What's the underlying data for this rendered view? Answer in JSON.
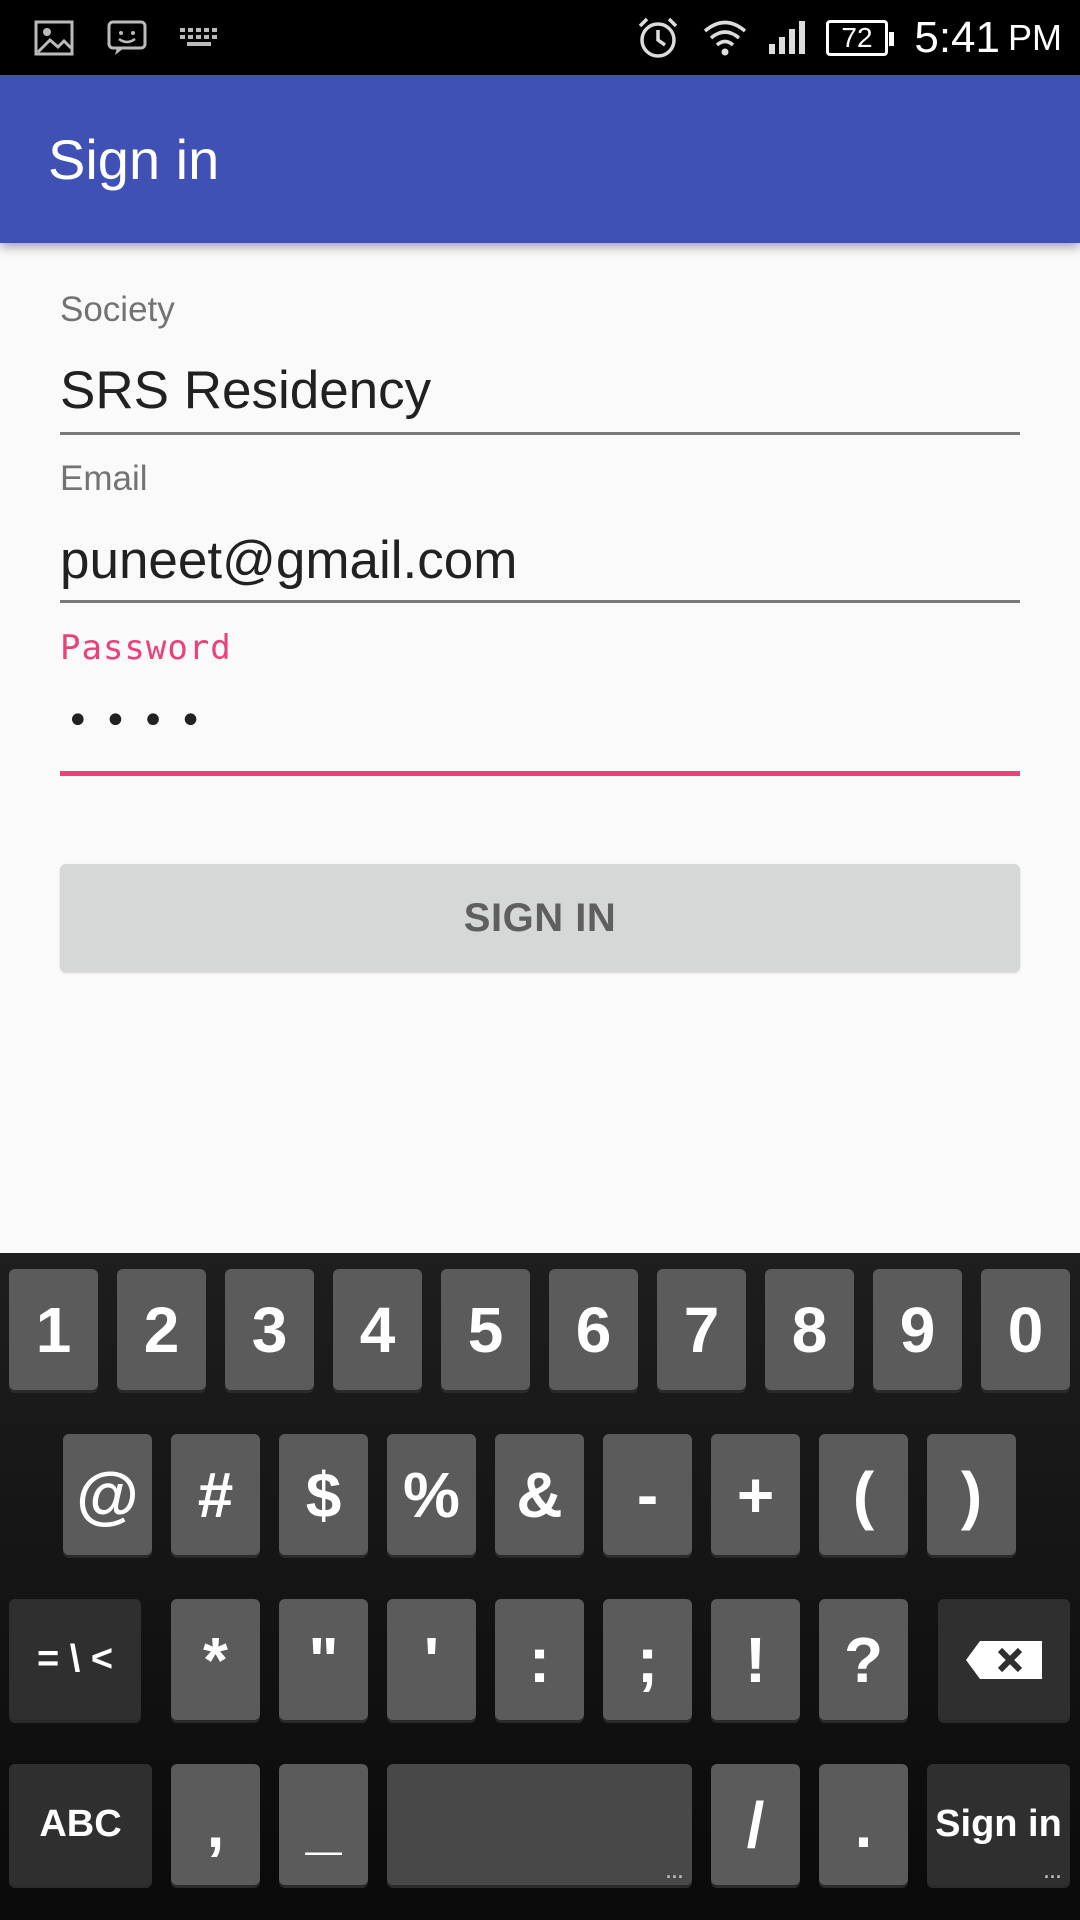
{
  "status_bar": {
    "icons": [
      "image-icon",
      "messenger-icon",
      "keyboard-icon",
      "alarm-icon",
      "wifi-icon",
      "signal-icon"
    ],
    "battery_level": "72",
    "time": "5:41",
    "ampm": "PM"
  },
  "app_bar": {
    "title": "Sign in",
    "color": "#3f51b5"
  },
  "form": {
    "society": {
      "label": "Society",
      "value": "SRS Residency"
    },
    "email": {
      "label": "Email",
      "value": "puneet@gmail.com"
    },
    "password": {
      "label": "Password",
      "value": "••••"
    },
    "accent_color": "#ec407a",
    "submit_label": "SIGN IN"
  },
  "keyboard": {
    "row1": [
      "1",
      "2",
      "3",
      "4",
      "5",
      "6",
      "7",
      "8",
      "9",
      "0"
    ],
    "row2": [
      "@",
      "#",
      "$",
      "%",
      "&",
      "-",
      "+",
      "(",
      ")"
    ],
    "row3_shift": "= \\ <",
    "row3": [
      "*",
      "\"",
      "'",
      ":",
      ";",
      "!",
      "?"
    ],
    "backspace_icon": "backspace-icon",
    "abc": "ABC",
    "comma": ",",
    "underscore": "_",
    "slash": "/",
    "period": ".",
    "action": "Sign in"
  }
}
